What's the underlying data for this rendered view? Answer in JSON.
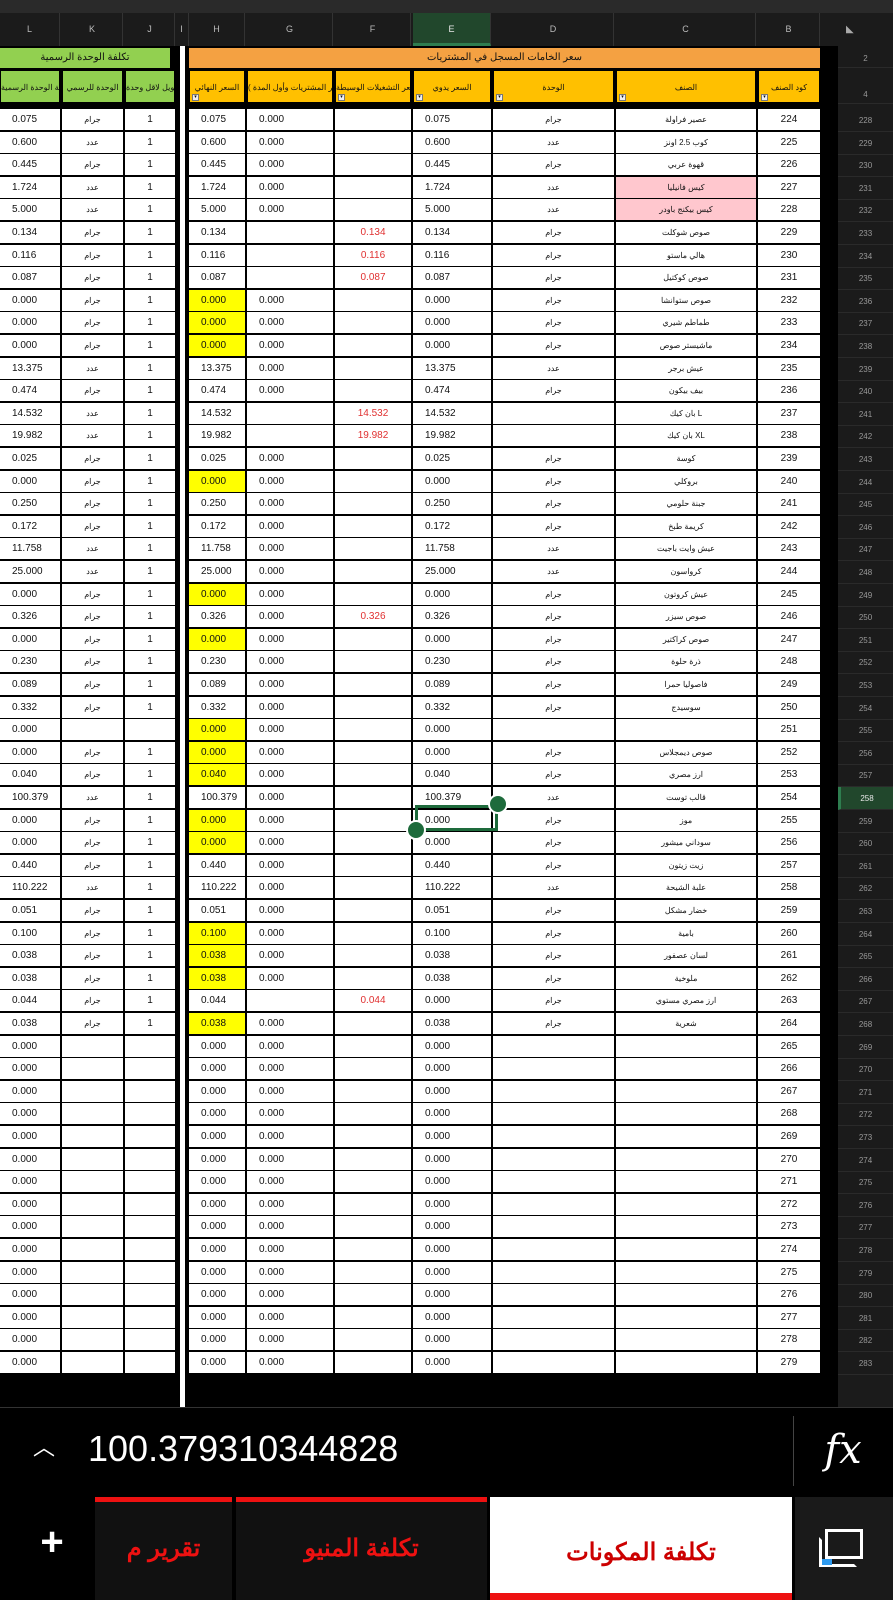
{
  "column_headers": [
    "L",
    "K",
    "J",
    "I",
    "H",
    "G",
    "F",
    "E",
    "D",
    "C",
    "B"
  ],
  "selected_column": "E",
  "top_row_numbers": [
    "2",
    "4"
  ],
  "band_labels": {
    "left": "تكلفة الوحدة الرسمية",
    "right": "سعر الخامات المسجل في المشتريات"
  },
  "table_headers": {
    "L": "تكلفة الوحدة الرسمية",
    "K": "الوحدة للرسمي",
    "J": "تحويل لاقل وحدة",
    "H": "السعر النهائي",
    "G": "السعر ( متوسط سعر المشتريات وأول المدة )",
    "F": "سعر التشغيلات الوسيطة",
    "E": "السعر يدوي",
    "D": "الوحدة",
    "C": "الصنف",
    "B": "كود الصنف"
  },
  "rows": [
    {
      "rn": "228",
      "L": "0.075",
      "K": "جرام",
      "J": "1",
      "H": "0.075",
      "G": "0.000",
      "F": "",
      "E": "0.075",
      "D": "جرام",
      "C": "عصير فراولة",
      "B": "224"
    },
    {
      "rn": "229",
      "L": "0.600",
      "K": "عدد",
      "J": "1",
      "H": "0.600",
      "G": "0.000",
      "F": "",
      "E": "0.600",
      "D": "عدد",
      "C": "كوب 2.5 اونز",
      "B": "225"
    },
    {
      "rn": "230",
      "L": "0.445",
      "K": "جرام",
      "J": "1",
      "H": "0.445",
      "G": "0.000",
      "F": "",
      "E": "0.445",
      "D": "جرام",
      "C": "قهوة عربي",
      "B": "226"
    },
    {
      "rn": "231",
      "L": "1.724",
      "K": "عدد",
      "J": "1",
      "H": "1.724",
      "G": "0.000",
      "F": "",
      "E": "1.724",
      "D": "عدد",
      "C": "كيس فانيليا",
      "B": "227",
      "pinkC": true
    },
    {
      "rn": "232",
      "L": "5.000",
      "K": "عدد",
      "J": "1",
      "H": "5.000",
      "G": "0.000",
      "F": "",
      "E": "5.000",
      "D": "عدد",
      "C": "كيس بيكنج باودر",
      "B": "228",
      "pinkC": true
    },
    {
      "rn": "233",
      "L": "0.134",
      "K": "جرام",
      "J": "1",
      "H": "0.134",
      "G": "",
      "F": "0.134",
      "E": "0.134",
      "D": "جرام",
      "C": "صوص شوكلت",
      "B": "229"
    },
    {
      "rn": "234",
      "L": "0.116",
      "K": "جرام",
      "J": "1",
      "H": "0.116",
      "G": "",
      "F": "0.116",
      "E": "0.116",
      "D": "جرام",
      "C": "هالي ماستو",
      "B": "230"
    },
    {
      "rn": "235",
      "L": "0.087",
      "K": "جرام",
      "J": "1",
      "H": "0.087",
      "G": "",
      "F": "0.087",
      "E": "0.087",
      "D": "جرام",
      "C": "صوص كوكتيل",
      "B": "231"
    },
    {
      "rn": "236",
      "L": "0.000",
      "K": "جرام",
      "J": "1",
      "H": "0.000",
      "G": "0.000",
      "F": "",
      "E": "0.000",
      "D": "جرام",
      "C": "صوص ستوانشا",
      "B": "232",
      "yelH": true
    },
    {
      "rn": "237",
      "L": "0.000",
      "K": "جرام",
      "J": "1",
      "H": "0.000",
      "G": "0.000",
      "F": "",
      "E": "0.000",
      "D": "جرام",
      "C": "طماطم شيري",
      "B": "233",
      "yelH": true
    },
    {
      "rn": "238",
      "L": "0.000",
      "K": "جرام",
      "J": "1",
      "H": "0.000",
      "G": "0.000",
      "F": "",
      "E": "0.000",
      "D": "جرام",
      "C": "ماشيستر صوص",
      "B": "234",
      "yelH": true
    },
    {
      "rn": "239",
      "L": "13.375",
      "K": "عدد",
      "J": "1",
      "H": "13.375",
      "G": "0.000",
      "F": "",
      "E": "13.375",
      "D": "عدد",
      "C": "عيش برجر",
      "B": "235"
    },
    {
      "rn": "240",
      "L": "0.474",
      "K": "جرام",
      "J": "1",
      "H": "0.474",
      "G": "0.000",
      "F": "",
      "E": "0.474",
      "D": "جرام",
      "C": "بيف بيكون",
      "B": "236"
    },
    {
      "rn": "241",
      "L": "14.532",
      "K": "عدد",
      "J": "1",
      "H": "14.532",
      "G": "",
      "F": "14.532",
      "E": "14.532",
      "D": "",
      "C": "بان كيك L",
      "B": "237"
    },
    {
      "rn": "242",
      "L": "19.982",
      "K": "عدد",
      "J": "1",
      "H": "19.982",
      "G": "",
      "F": "19.982",
      "E": "19.982",
      "D": "",
      "C": "بان كيك XL",
      "B": "238"
    },
    {
      "rn": "243",
      "L": "0.025",
      "K": "جرام",
      "J": "1",
      "H": "0.025",
      "G": "0.000",
      "F": "",
      "E": "0.025",
      "D": "جرام",
      "C": "كوسة",
      "B": "239"
    },
    {
      "rn": "244",
      "L": "0.000",
      "K": "جرام",
      "J": "1",
      "H": "0.000",
      "G": "0.000",
      "F": "",
      "E": "0.000",
      "D": "جرام",
      "C": "بروكلي",
      "B": "240",
      "yelH": true
    },
    {
      "rn": "245",
      "L": "0.250",
      "K": "جرام",
      "J": "1",
      "H": "0.250",
      "G": "0.000",
      "F": "",
      "E": "0.250",
      "D": "جرام",
      "C": "جبنة حلومي",
      "B": "241"
    },
    {
      "rn": "246",
      "L": "0.172",
      "K": "جرام",
      "J": "1",
      "H": "0.172",
      "G": "0.000",
      "F": "",
      "E": "0.172",
      "D": "جرام",
      "C": "كريمة طبخ",
      "B": "242"
    },
    {
      "rn": "247",
      "L": "11.758",
      "K": "عدد",
      "J": "1",
      "H": "11.758",
      "G": "0.000",
      "F": "",
      "E": "11.758",
      "D": "عدد",
      "C": "عيش وايت باجيت",
      "B": "243"
    },
    {
      "rn": "248",
      "L": "25.000",
      "K": "عدد",
      "J": "1",
      "H": "25.000",
      "G": "0.000",
      "F": "",
      "E": "25.000",
      "D": "عدد",
      "C": "كرواسون",
      "B": "244"
    },
    {
      "rn": "249",
      "L": "0.000",
      "K": "جرام",
      "J": "1",
      "H": "0.000",
      "G": "0.000",
      "F": "",
      "E": "0.000",
      "D": "جرام",
      "C": "عيش كروتون",
      "B": "245",
      "yelH": true
    },
    {
      "rn": "250",
      "L": "0.326",
      "K": "جرام",
      "J": "1",
      "H": "0.326",
      "G": "0.000",
      "F": "0.326",
      "E": "0.326",
      "D": "جرام",
      "C": "صوص سيزر",
      "B": "246"
    },
    {
      "rn": "251",
      "L": "0.000",
      "K": "جرام",
      "J": "1",
      "H": "0.000",
      "G": "0.000",
      "F": "",
      "E": "0.000",
      "D": "جرام",
      "C": "صوص كراكتير",
      "B": "247",
      "yelH": true
    },
    {
      "rn": "252",
      "L": "0.230",
      "K": "جرام",
      "J": "1",
      "H": "0.230",
      "G": "0.000",
      "F": "",
      "E": "0.230",
      "D": "جرام",
      "C": "ذرة حلوة",
      "B": "248"
    },
    {
      "rn": "253",
      "L": "0.089",
      "K": "جرام",
      "J": "1",
      "H": "0.089",
      "G": "0.000",
      "F": "",
      "E": "0.089",
      "D": "جرام",
      "C": "فاصوليا حمرا",
      "B": "249"
    },
    {
      "rn": "254",
      "L": "0.332",
      "K": "جرام",
      "J": "1",
      "H": "0.332",
      "G": "0.000",
      "F": "",
      "E": "0.332",
      "D": "جرام",
      "C": "سوسيدج",
      "B": "250"
    },
    {
      "rn": "255",
      "L": "0.000",
      "K": "",
      "J": "",
      "H": "0.000",
      "G": "0.000",
      "F": "",
      "E": "0.000",
      "D": "",
      "C": "",
      "B": "251",
      "yelH": true
    },
    {
      "rn": "256",
      "L": "0.000",
      "K": "جرام",
      "J": "1",
      "H": "0.000",
      "G": "0.000",
      "F": "",
      "E": "0.000",
      "D": "جرام",
      "C": "صوص ديمجلاس",
      "B": "252",
      "yelH": true
    },
    {
      "rn": "257",
      "L": "0.040",
      "K": "جرام",
      "J": "1",
      "H": "0.040",
      "G": "0.000",
      "F": "",
      "E": "0.040",
      "D": "جرام",
      "C": "ارز مصري",
      "B": "253",
      "yelH": true
    },
    {
      "rn": "258",
      "L": "100.379",
      "K": "عدد",
      "J": "1",
      "H": "100.379",
      "G": "0.000",
      "F": "",
      "E": "100.379",
      "D": "عدد",
      "C": "قالب توست",
      "B": "254",
      "sel": true
    },
    {
      "rn": "259",
      "L": "0.000",
      "K": "جرام",
      "J": "1",
      "H": "0.000",
      "G": "0.000",
      "F": "",
      "E": "0.000",
      "D": "جرام",
      "C": "موز",
      "B": "255",
      "yelH": true
    },
    {
      "rn": "260",
      "L": "0.000",
      "K": "جرام",
      "J": "1",
      "H": "0.000",
      "G": "0.000",
      "F": "",
      "E": "0.000",
      "D": "جرام",
      "C": "سوداني ميشور",
      "B": "256",
      "yelH": true
    },
    {
      "rn": "261",
      "L": "0.440",
      "K": "جرام",
      "J": "1",
      "H": "0.440",
      "G": "0.000",
      "F": "",
      "E": "0.440",
      "D": "جرام",
      "C": "زيت زيتون",
      "B": "257"
    },
    {
      "rn": "262",
      "L": "110.222",
      "K": "عدد",
      "J": "1",
      "H": "110.222",
      "G": "0.000",
      "F": "",
      "E": "110.222",
      "D": "عدد",
      "C": "علبة الشيحة",
      "B": "258"
    },
    {
      "rn": "263",
      "L": "0.051",
      "K": "جرام",
      "J": "1",
      "H": "0.051",
      "G": "0.000",
      "F": "",
      "E": "0.051",
      "D": "جرام",
      "C": "خضار مشكل",
      "B": "259"
    },
    {
      "rn": "264",
      "L": "0.100",
      "K": "جرام",
      "J": "1",
      "H": "0.100",
      "G": "0.000",
      "F": "",
      "E": "0.100",
      "D": "جرام",
      "C": "بامية",
      "B": "260",
      "yelH": true
    },
    {
      "rn": "265",
      "L": "0.038",
      "K": "جرام",
      "J": "1",
      "H": "0.038",
      "G": "0.000",
      "F": "",
      "E": "0.038",
      "D": "جرام",
      "C": "لسان عصفور",
      "B": "261",
      "yelH": true
    },
    {
      "rn": "266",
      "L": "0.038",
      "K": "جرام",
      "J": "1",
      "H": "0.038",
      "G": "0.000",
      "F": "",
      "E": "0.038",
      "D": "جرام",
      "C": "ملوخية",
      "B": "262",
      "yelH": true
    },
    {
      "rn": "267",
      "L": "0.044",
      "K": "جرام",
      "J": "1",
      "H": "0.044",
      "G": "",
      "F": "0.044",
      "E": "0.000",
      "D": "جرام",
      "C": "ارز مصري مستوي",
      "B": "263"
    },
    {
      "rn": "268",
      "L": "0.038",
      "K": "جرام",
      "J": "1",
      "H": "0.038",
      "G": "0.000",
      "F": "",
      "E": "0.038",
      "D": "جرام",
      "C": "شعرية",
      "B": "264",
      "yelH": true
    },
    {
      "rn": "269",
      "L": "0.000",
      "K": "",
      "J": "",
      "H": "0.000",
      "G": "0.000",
      "F": "",
      "E": "0.000",
      "D": "",
      "C": "",
      "B": "265"
    },
    {
      "rn": "270",
      "L": "0.000",
      "K": "",
      "J": "",
      "H": "0.000",
      "G": "0.000",
      "F": "",
      "E": "0.000",
      "D": "",
      "C": "",
      "B": "266"
    },
    {
      "rn": "271",
      "L": "0.000",
      "K": "",
      "J": "",
      "H": "0.000",
      "G": "0.000",
      "F": "",
      "E": "0.000",
      "D": "",
      "C": "",
      "B": "267"
    },
    {
      "rn": "272",
      "L": "0.000",
      "K": "",
      "J": "",
      "H": "0.000",
      "G": "0.000",
      "F": "",
      "E": "0.000",
      "D": "",
      "C": "",
      "B": "268"
    },
    {
      "rn": "273",
      "L": "0.000",
      "K": "",
      "J": "",
      "H": "0.000",
      "G": "0.000",
      "F": "",
      "E": "0.000",
      "D": "",
      "C": "",
      "B": "269"
    },
    {
      "rn": "274",
      "L": "0.000",
      "K": "",
      "J": "",
      "H": "0.000",
      "G": "0.000",
      "F": "",
      "E": "0.000",
      "D": "",
      "C": "",
      "B": "270"
    },
    {
      "rn": "275",
      "L": "0.000",
      "K": "",
      "J": "",
      "H": "0.000",
      "G": "0.000",
      "F": "",
      "E": "0.000",
      "D": "",
      "C": "",
      "B": "271"
    },
    {
      "rn": "276",
      "L": "0.000",
      "K": "",
      "J": "",
      "H": "0.000",
      "G": "0.000",
      "F": "",
      "E": "0.000",
      "D": "",
      "C": "",
      "B": "272"
    },
    {
      "rn": "277",
      "L": "0.000",
      "K": "",
      "J": "",
      "H": "0.000",
      "G": "0.000",
      "F": "",
      "E": "0.000",
      "D": "",
      "C": "",
      "B": "273"
    },
    {
      "rn": "278",
      "L": "0.000",
      "K": "",
      "J": "",
      "H": "0.000",
      "G": "0.000",
      "F": "",
      "E": "0.000",
      "D": "",
      "C": "",
      "B": "274"
    },
    {
      "rn": "279",
      "L": "0.000",
      "K": "",
      "J": "",
      "H": "0.000",
      "G": "0.000",
      "F": "",
      "E": "0.000",
      "D": "",
      "C": "",
      "B": "275"
    },
    {
      "rn": "280",
      "L": "0.000",
      "K": "",
      "J": "",
      "H": "0.000",
      "G": "0.000",
      "F": "",
      "E": "0.000",
      "D": "",
      "C": "",
      "B": "276"
    },
    {
      "rn": "281",
      "L": "0.000",
      "K": "",
      "J": "",
      "H": "0.000",
      "G": "0.000",
      "F": "",
      "E": "0.000",
      "D": "",
      "C": "",
      "B": "277"
    },
    {
      "rn": "282",
      "L": "0.000",
      "K": "",
      "J": "",
      "H": "0.000",
      "G": "0.000",
      "F": "",
      "E": "0.000",
      "D": "",
      "C": "",
      "B": "278"
    },
    {
      "rn": "283",
      "L": "0.000",
      "K": "",
      "J": "",
      "H": "0.000",
      "G": "0.000",
      "F": "",
      "E": "0.000",
      "D": "",
      "C": "",
      "B": "279"
    }
  ],
  "formula_bar": {
    "value": "100.379310344828",
    "fx_label": "fx",
    "chevron": "^"
  },
  "tabs": [
    {
      "label": "تقرير م",
      "active": false
    },
    {
      "label": "تكلفة المنيو",
      "active": false
    },
    {
      "label": "تكلفة المكونات",
      "active": true
    }
  ],
  "colors": {
    "header_orange": "#ffc000",
    "header_green": "#92d050",
    "highlight_yellow": "#ffff00",
    "highlight_pink": "#ffc7ce",
    "selection_green": "#1e6b3c",
    "tab_red": "#e11111"
  },
  "icons": {
    "add_sheet": "plus-icon",
    "sheets_list": "sheets-icon",
    "expand": "chevron-up-icon",
    "function": "fx-icon"
  }
}
